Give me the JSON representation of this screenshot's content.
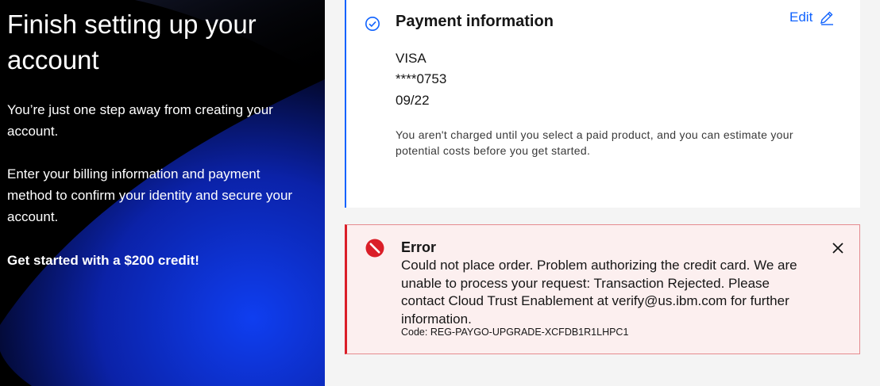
{
  "left": {
    "heading": "Finish setting up your account",
    "paragraph1": "You’re just one step away from creating your account.",
    "paragraph2": "Enter your billing information and payment method to confirm your identity and secure your account.",
    "promo": "Get started with a $200 credit!"
  },
  "payment": {
    "title": "Payment information",
    "edit_label": "Edit",
    "card_brand": "VISA",
    "card_number": "****0753",
    "card_expiry": "09/22",
    "note": "You aren't charged until you select a paid product, and you can estimate your potential costs before you get started.",
    "icons": {
      "status": "checkmark-outline-icon",
      "edit": "pencil-icon"
    }
  },
  "error": {
    "title": "Error",
    "message": "Could not place order. Problem authorizing the credit card. We are unable to process your request: Transaction Rejected. Please contact Cloud Trust Enablement at verify@us.ibm.com for further information.",
    "code": "Code: REG-PAYGO-UPGRADE-XCFDB1R1LHPC1",
    "icons": {
      "status": "error-filled-icon",
      "close": "close-icon"
    }
  },
  "colors": {
    "accent": "#0f62fe",
    "error_red": "#da1e28",
    "error_bg": "#fcefef",
    "page_bg": "#f4f4f4",
    "left_panel_gradient": [
      "#000000",
      "#0b1fa8",
      "#0f3ef0"
    ]
  }
}
